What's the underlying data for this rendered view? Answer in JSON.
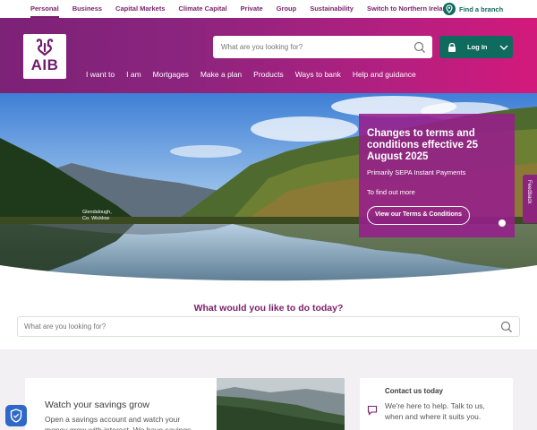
{
  "topnav": {
    "items": [
      "Personal",
      "Business",
      "Capital Markets",
      "Climate Capital",
      "Private",
      "Group",
      "Sustainability",
      "Switch to Northern Ireland"
    ],
    "find_branch": "Find a branch"
  },
  "header": {
    "logo_text": "AIB",
    "search_placeholder": "What are you looking for?",
    "login_label": "Log In",
    "nav": [
      "I want to",
      "I am",
      "Mortgages",
      "Make a plan",
      "Products",
      "Ways to bank",
      "Help and guidance"
    ]
  },
  "hero": {
    "caption_line1": "Glendalough,",
    "caption_line2": "Co. Wicklow",
    "promo_title": "Changes to terms and conditions effective 25 August 2025",
    "promo_subtitle": "Primarily SEPA Instant Payments",
    "promo_more": "To find out more",
    "promo_cta": "View our Terms & Conditions",
    "feedback_label": "Feedback"
  },
  "what_would_you": {
    "title": "What would you like to do today?",
    "search_placeholder": "What are you looking for?"
  },
  "cards": {
    "savings_title": "Watch your savings grow",
    "savings_text": "Open a savings account and watch your money grow with interest. We have savings",
    "contact_title": "Contact us today",
    "contact_text": "We're here to help. Talk to us, when and where it suits you."
  },
  "colors": {
    "brand_purple": "#7b1e6b",
    "brand_magenta": "#d3197c",
    "accent_green": "#0f6b5e"
  },
  "icons": {
    "branch": "location-pin-icon",
    "search": "search-icon",
    "login": "lock-icon",
    "chevron": "chevron-down-icon",
    "chat": "chat-icon",
    "security": "shield-icon"
  }
}
